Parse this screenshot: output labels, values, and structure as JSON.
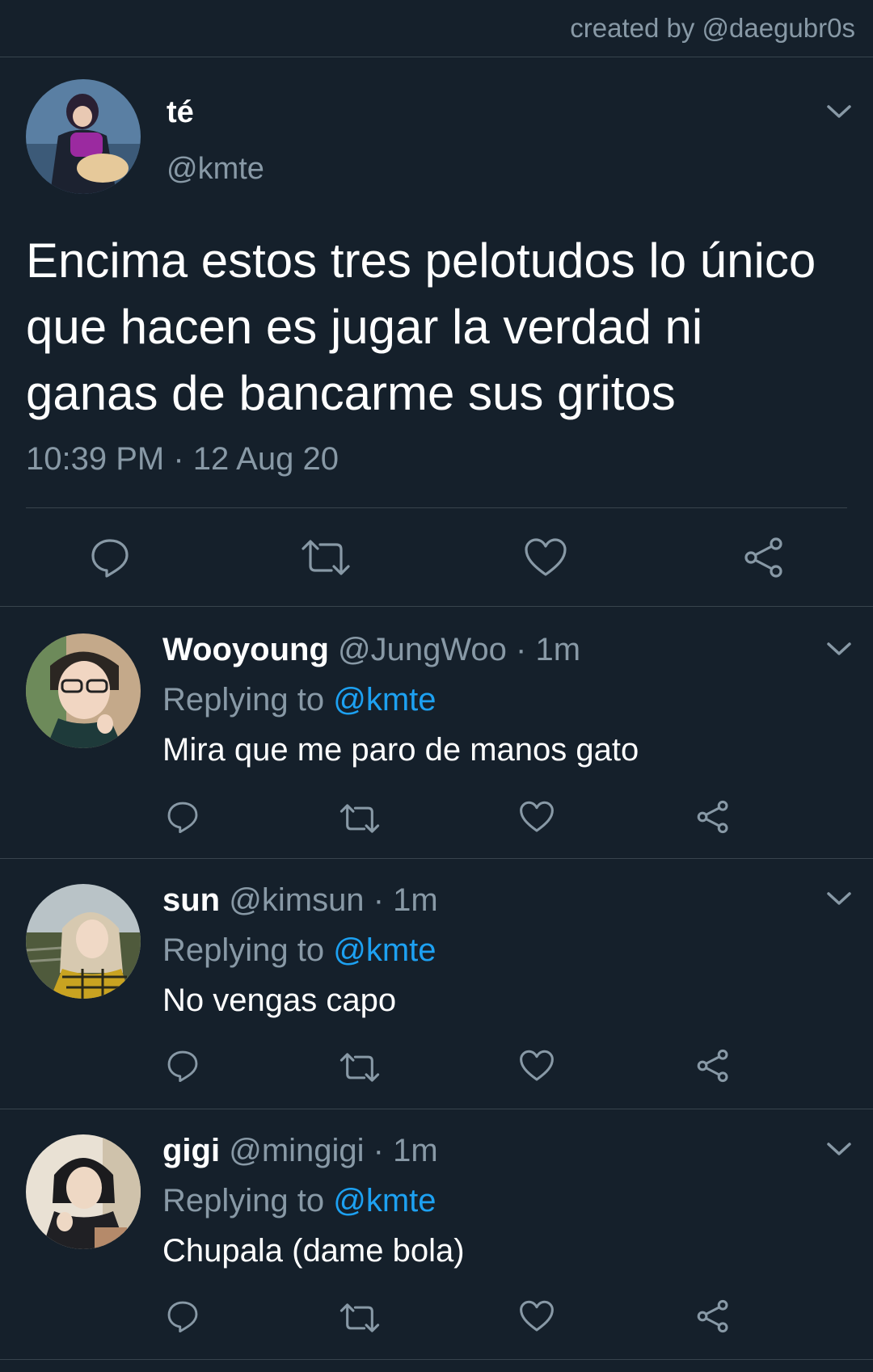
{
  "credit": "created by @daegubr0s",
  "main_tweet": {
    "name": "té",
    "handle": "@kmte",
    "text": "Encima estos tres pelotudos lo único que hacen es jugar la verdad ni ganas de bancarme sus gritos",
    "timestamp": "10:39 PM · 12 Aug 20",
    "actions": [
      "reply-icon",
      "retweet-icon",
      "like-icon",
      "share-icon"
    ]
  },
  "replies": [
    {
      "name": "Wooyoung",
      "handle": "@JungWoo",
      "separator": "·",
      "time": "1m",
      "replying_prefix": "Replying to",
      "replying_to": "@kmte",
      "text": "Mira que me paro de manos gato"
    },
    {
      "name": "sun",
      "handle": "@kimsun",
      "separator": "·",
      "time": "1m",
      "replying_prefix": "Replying to",
      "replying_to": "@kmte",
      "text": "No vengas capo"
    },
    {
      "name": "gigi",
      "handle": "@mingigi",
      "separator": "·",
      "time": "1m",
      "replying_prefix": "Replying to",
      "replying_to": "@kmte",
      "text": "Chupala (dame bola)"
    }
  ],
  "colors": {
    "background": "#15202b",
    "divider": "#38444d",
    "secondary_text": "#8899a6",
    "link": "#1da1f2"
  }
}
